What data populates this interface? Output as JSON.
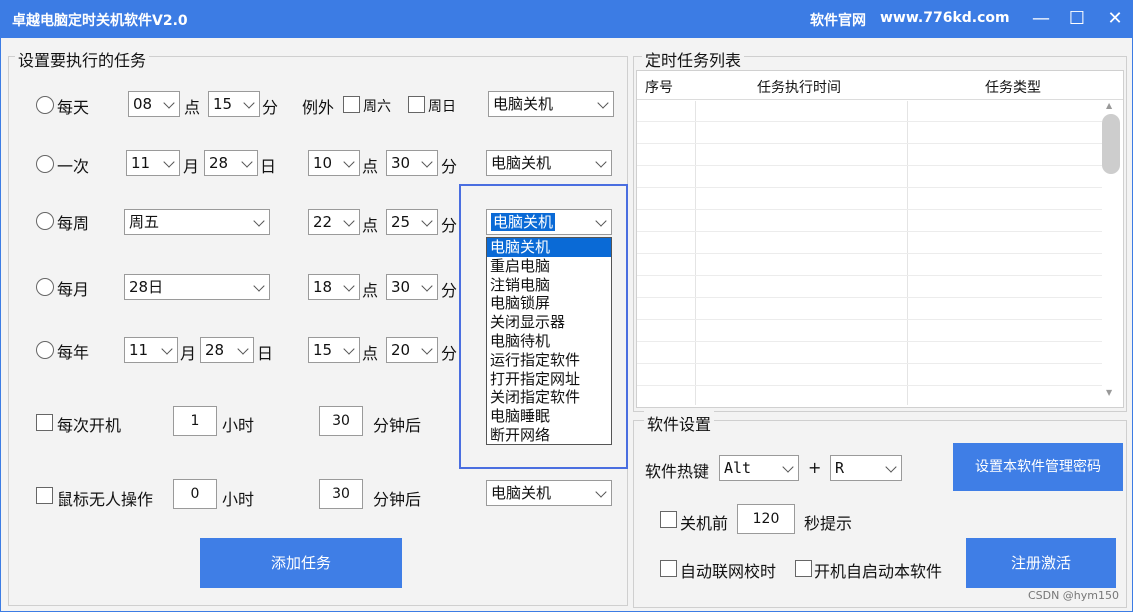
{
  "window": {
    "title": "卓越电脑定时关机软件V2.0",
    "site_label": "软件官网",
    "site_url": "www.776kd.com",
    "min": "—",
    "max": "☐",
    "close": "✕"
  },
  "tasks": {
    "group_title": "设置要执行的任务",
    "daily": {
      "label": "每天",
      "hour": "08",
      "hour_unit": "点",
      "minute": "15",
      "minute_unit": "分",
      "except": "例外",
      "sat": "周六",
      "sun": "周日",
      "action": "电脑关机"
    },
    "once": {
      "label": "一次",
      "month": "11",
      "month_unit": "月",
      "day": "28",
      "day_unit": "日",
      "hour": "10",
      "hour_unit": "点",
      "minute": "30",
      "minute_unit": "分",
      "action": "电脑关机"
    },
    "weekly": {
      "label": "每周",
      "weekday": "周五",
      "hour": "22",
      "hour_unit": "点",
      "minute": "25",
      "minute_unit": "分",
      "action": "电脑关机"
    },
    "monthly": {
      "label": "每月",
      "day": "28日",
      "hour": "18",
      "hour_unit": "点",
      "minute": "30",
      "minute_unit": "分"
    },
    "yearly": {
      "label": "每年",
      "month": "11",
      "month_unit": "月",
      "day": "28",
      "day_unit": "日",
      "hour": "15",
      "hour_unit": "点",
      "minute": "20",
      "minute_unit": "分"
    },
    "startup": {
      "label": "每次开机",
      "hours": "1",
      "hours_unit": "小时",
      "minutes": "30",
      "minutes_unit": "分钟后"
    },
    "idle": {
      "label": "鼠标无人操作",
      "hours": "0",
      "hours_unit": "小时",
      "minutes": "30",
      "minutes_unit": "分钟后",
      "action": "电脑关机"
    },
    "add_button": "添加任务"
  },
  "dropdown_options": [
    "电脑关机",
    "重启电脑",
    "注销电脑",
    "电脑锁屏",
    "关闭显示器",
    "电脑待机",
    "运行指定软件",
    "打开指定网址",
    "关闭指定软件",
    "电脑睡眠",
    "断开网络"
  ],
  "task_list": {
    "title": "定时任务列表",
    "col_index": "序号",
    "col_time": "任务执行时间",
    "col_type": "任务类型"
  },
  "settings": {
    "title": "软件设置",
    "hotkey_label": "软件热键",
    "hotkey_mod": "Alt",
    "plus": "+",
    "hotkey_key": "R",
    "password_button": "设置本软件管理密码",
    "before_shutdown": "关机前",
    "before_seconds": "120",
    "seconds_hint": "秒提示",
    "auto_sync": "自动联网校时",
    "autostart": "开机自启动本软件",
    "register_button": "注册激活"
  },
  "watermark": "CSDN @hym150",
  "colors": {
    "accent": "#3c7ce4",
    "selected": "#0a6ad6",
    "highlight_frame": "#4a6ee0"
  }
}
